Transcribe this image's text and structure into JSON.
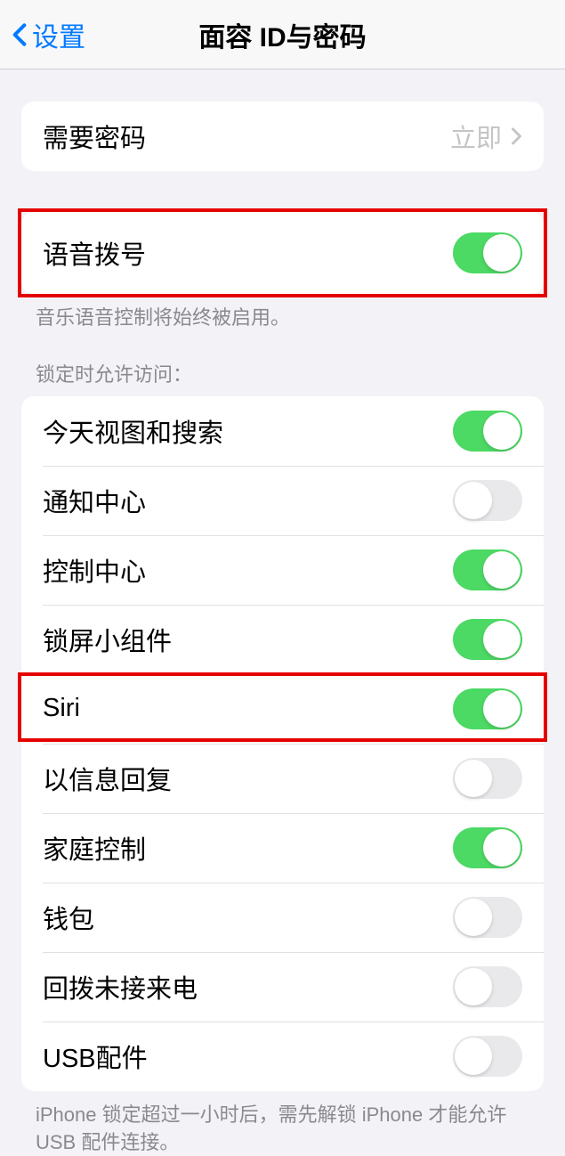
{
  "nav": {
    "back_label": "设置",
    "title": "面容 ID与密码"
  },
  "require_passcode": {
    "label": "需要密码",
    "value": "立即"
  },
  "voice_dial": {
    "label": "语音拨号",
    "on": true,
    "footer": "音乐语音控制将始终被启用。"
  },
  "allow_access_header": "锁定时允许访问：",
  "access_items": [
    {
      "label": "今天视图和搜索",
      "on": true
    },
    {
      "label": "通知中心",
      "on": false
    },
    {
      "label": "控制中心",
      "on": true
    },
    {
      "label": "锁屏小组件",
      "on": true
    },
    {
      "label": "Siri",
      "on": true
    },
    {
      "label": "以信息回复",
      "on": false
    },
    {
      "label": "家庭控制",
      "on": true
    },
    {
      "label": "钱包",
      "on": false
    },
    {
      "label": "回拨未接来电",
      "on": false
    },
    {
      "label": "USB配件",
      "on": false
    }
  ],
  "usb_footer": "iPhone 锁定超过一小时后，需先解锁 iPhone 才能允许USB 配件连接。",
  "highlights": {
    "voice_dial": true,
    "siri_index": 4
  }
}
